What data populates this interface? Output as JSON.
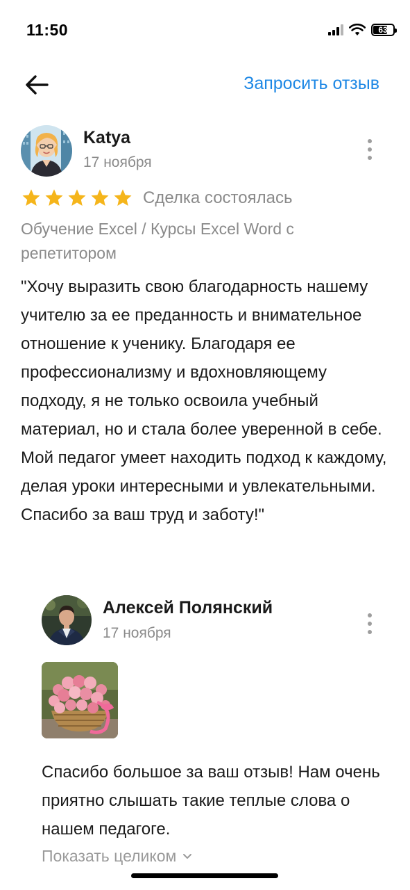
{
  "status_bar": {
    "time": "11:50",
    "battery": "63"
  },
  "header": {
    "request_review_label": "Запросить отзыв"
  },
  "review": {
    "reviewer_name": "Katya",
    "date": "17 ноября",
    "rating": 5,
    "rating_max": 5,
    "deal_status": "Сделка состоялась",
    "service": "Обучение Excel / Курсы Excel Word с репетитором",
    "text": "\"Хочу выразить свою благодарность нашему учителю  за ее преданность и внимательное отношение к ученику. Благодаря ее профессионализму и вдохновляющему подходу, я не только освоила учебный материал, но и стала более уверенной в себе. Мой педагог умеет находить подход к каждому, делая уроки интересными и увлекательными. Спасибо за ваш труд и заботу!\""
  },
  "reply": {
    "author_name": "Алексей Полянский",
    "date": "17 ноября",
    "text": "Спасибо большое за ваш отзыв! Нам очень приятно слышать такие теплые слова о нашем педагоге.",
    "show_more_label": "Показать целиком"
  },
  "colors": {
    "accent": "#1e88e5",
    "star": "#f5b51b",
    "secondary_text": "#8a8a8a"
  },
  "icons": {
    "back": "arrow-left-icon",
    "more": "more-vertical-icon",
    "star": "star-icon",
    "chevron": "chevron-down-icon"
  }
}
